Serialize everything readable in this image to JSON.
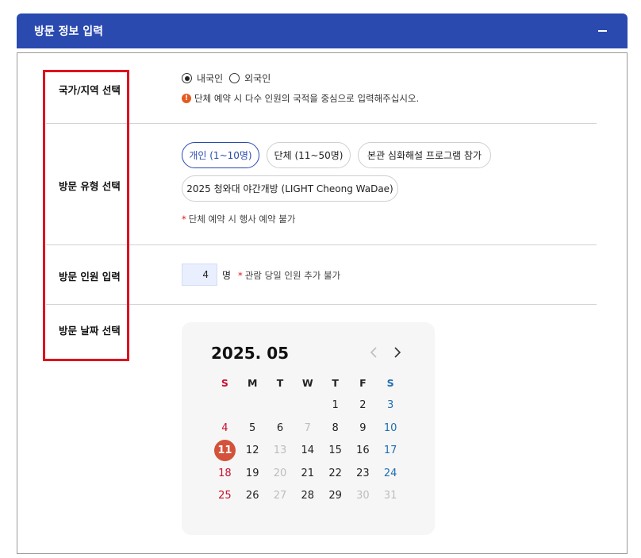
{
  "header": {
    "title": "방문 정보 입력",
    "collapse_icon": "minus-icon"
  },
  "sections": {
    "nationality": {
      "label": "국가/지역 선택",
      "options": [
        {
          "label": "내국인",
          "checked": true
        },
        {
          "label": "외국인",
          "checked": false
        }
      ],
      "notice": "단체 예약 시 다수 인원의 국적을 중심으로 입력해주십시오."
    },
    "visit_type": {
      "label": "방문 유형 선택",
      "chips": [
        {
          "label": "개인 (1~10명)",
          "active": true
        },
        {
          "label": "단체 (11~50명)",
          "active": false
        },
        {
          "label": "본관 심화해설 프로그램 참가",
          "active": false
        },
        {
          "label": "2025 청와대 야간개방 (LIGHT Cheong WaDae)",
          "active": false
        }
      ],
      "note": "단체 예약 시 행사 예약 불가"
    },
    "headcount": {
      "label": "방문 인원 입력",
      "value": "4",
      "unit": "명",
      "note": "관람 당일 인원 추가 불가"
    },
    "date": {
      "label": "방문 날짜 선택"
    }
  },
  "calendar": {
    "title": "2025. 05",
    "weekdays": [
      "S",
      "M",
      "T",
      "W",
      "T",
      "F",
      "S"
    ],
    "weeks": [
      [
        "",
        "",
        "",
        "",
        "1",
        "2",
        "3"
      ],
      [
        "4",
        "5",
        "6",
        "7",
        "8",
        "9",
        "10"
      ],
      [
        "11",
        "12",
        "13",
        "14",
        "15",
        "16",
        "17"
      ],
      [
        "18",
        "19",
        "20",
        "21",
        "22",
        "23",
        "24"
      ],
      [
        "25",
        "26",
        "27",
        "28",
        "29",
        "30",
        "31"
      ]
    ],
    "disabled": [
      "7",
      "13",
      "20",
      "27",
      "30",
      "31"
    ],
    "selected": "11",
    "colors": {
      "sunday": "#c8102e",
      "saturday": "#1f6fb2",
      "selected_bg": "#d4513a",
      "accent": "#2a4ab0"
    }
  }
}
